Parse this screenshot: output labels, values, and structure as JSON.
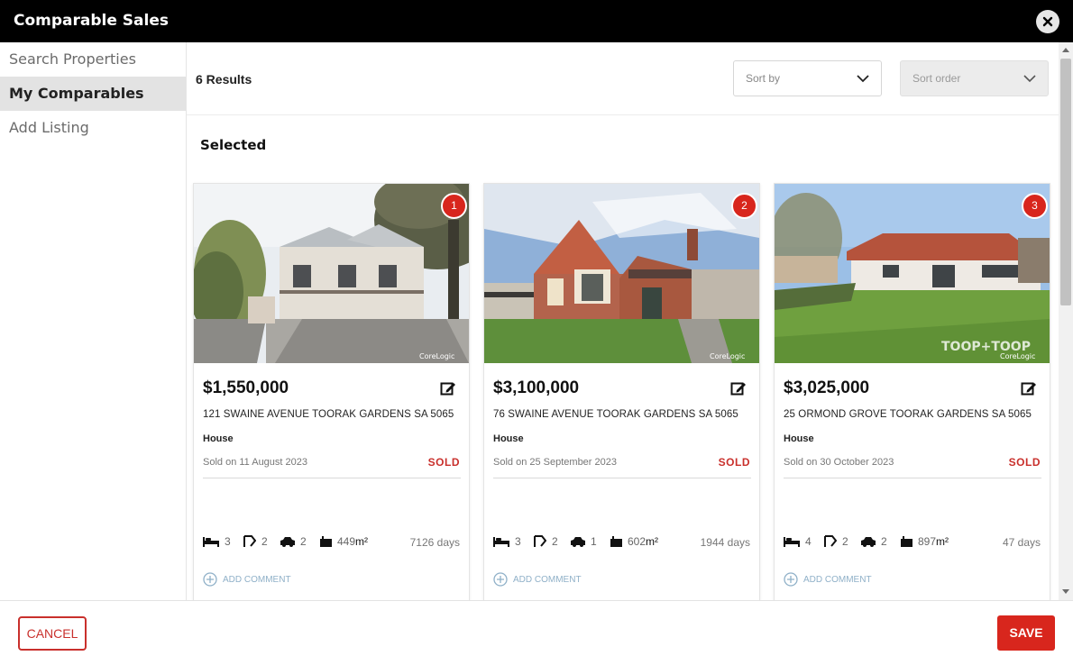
{
  "header": {
    "title": "Comparable Sales"
  },
  "sidebar": {
    "items": [
      {
        "label": "Search Properties",
        "active": false
      },
      {
        "label": "My Comparables",
        "active": true
      },
      {
        "label": "Add Listing",
        "active": false
      }
    ]
  },
  "main": {
    "results": "6 Results",
    "sort_by": {
      "placeholder": "Sort by"
    },
    "sort_order": {
      "placeholder": "Sort order"
    },
    "section_title": "Selected"
  },
  "cards": [
    {
      "badge": "1",
      "price": "$1,550,000",
      "address": "121 SWAINE AVENUE TOORAK GARDENS SA 5065",
      "type": "House",
      "sold_date": "Sold on 11 August 2023",
      "status": "SOLD",
      "beds": "3",
      "baths": "2",
      "cars": "2",
      "land": "449",
      "land_unit": "m²",
      "days": "7126 days",
      "comment": "ADD COMMENT",
      "watermark": "CoreLogic"
    },
    {
      "badge": "2",
      "price": "$3,100,000",
      "address": "76 SWAINE AVENUE TOORAK GARDENS SA 5065",
      "type": "House",
      "sold_date": "Sold on 25 September 2023",
      "status": "SOLD",
      "beds": "3",
      "baths": "2",
      "cars": "1",
      "land": "602",
      "land_unit": "m²",
      "days": "1944 days",
      "comment": "ADD COMMENT",
      "watermark": "CoreLogic"
    },
    {
      "badge": "3",
      "price": "$3,025,000",
      "address": "25 ORMOND GROVE TOORAK GARDENS SA 5065",
      "type": "House",
      "sold_date": "Sold on 30 October 2023",
      "status": "SOLD",
      "beds": "4",
      "baths": "2",
      "cars": "2",
      "land": "897",
      "land_unit": "m²",
      "days": "47 days",
      "comment": "ADD COMMENT",
      "watermark": "CoreLogic",
      "agency_mark": "TOOP+TOOP"
    }
  ],
  "footer": {
    "cancel_label": "CANCEL",
    "save_label": "SAVE"
  },
  "colors": {
    "accent": "#d8261d",
    "header": "#000000",
    "sold": "#c9302c"
  }
}
